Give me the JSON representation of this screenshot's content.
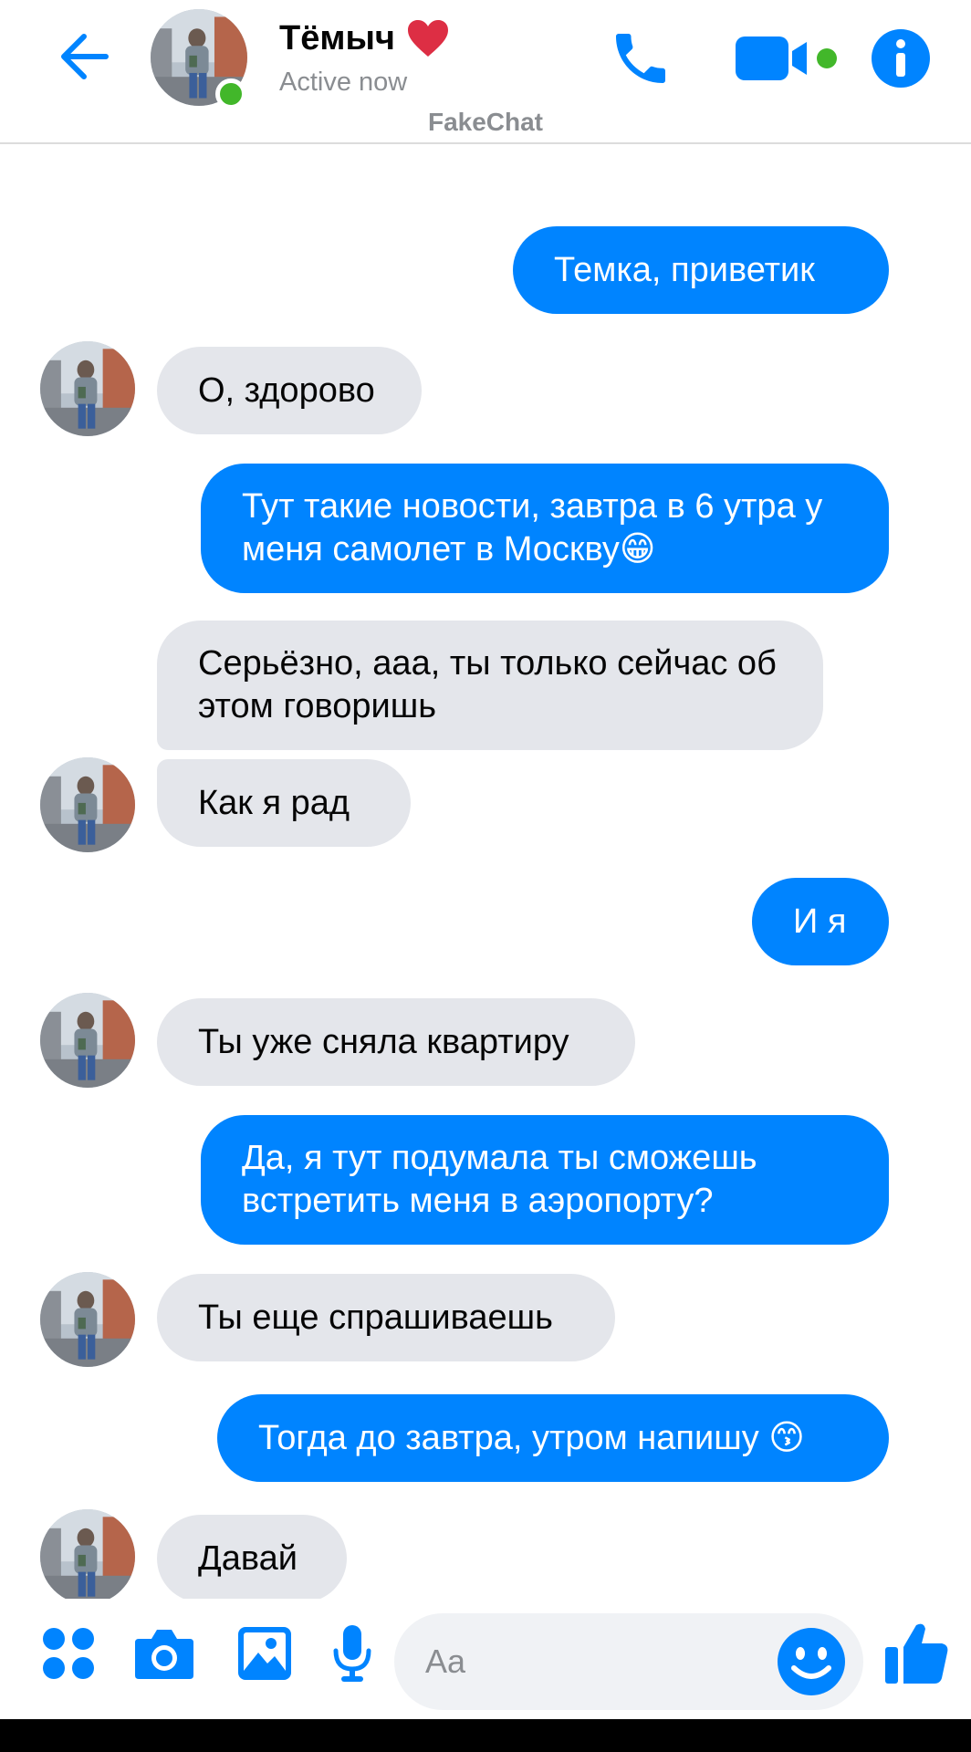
{
  "header": {
    "contact_name": "Тёмыч",
    "status": "Active now",
    "watermark": "FakeChat"
  },
  "colors": {
    "accent": "#0084ff",
    "incoming_bubble": "#e4e6eb",
    "online": "#42b72a"
  },
  "icons": [
    "back-arrow-icon",
    "phone-icon",
    "video-camera-icon",
    "info-icon",
    "apps-icon",
    "camera-icon",
    "gallery-icon",
    "microphone-icon",
    "emoji-icon",
    "thumbs-up-icon"
  ],
  "messages": [
    {
      "from": "me",
      "text": "Темка, приветик"
    },
    {
      "from": "them",
      "text": "О, здорово"
    },
    {
      "from": "me",
      "text": "Тут такие новости, завтра в 6 утра у меня самолет в Москву😁"
    },
    {
      "from": "them",
      "text": "Серьёзно, ааа, ты только сейчас об этом говоришь"
    },
    {
      "from": "them",
      "text": "Как я рад"
    },
    {
      "from": "me",
      "text": "И я"
    },
    {
      "from": "them",
      "text": "Ты уже сняла квартиру"
    },
    {
      "from": "me",
      "text": "Да, я тут подумала ты сможешь встретить меня в аэропорту?"
    },
    {
      "from": "them",
      "text": "Ты еще спрашиваешь"
    },
    {
      "from": "me",
      "text": "Тогда до завтра, утром напишу 😙"
    },
    {
      "from": "them",
      "text": "Давай"
    }
  ],
  "composer": {
    "placeholder": "Aa"
  }
}
